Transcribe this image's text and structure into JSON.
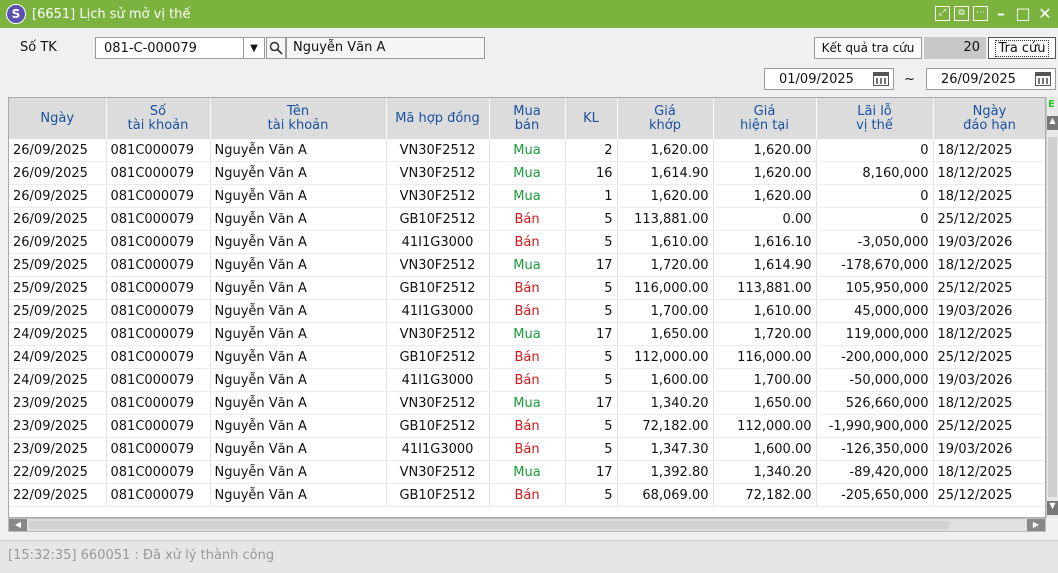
{
  "window": {
    "logo": "S",
    "title": "[6651] Lịch sử mở vị thế"
  },
  "filter": {
    "account_label": "Số TK",
    "account_value": "081-C-000079",
    "account_name": "Nguyễn Văn A",
    "result_label": "Kết quả tra cứu",
    "result_count": "20",
    "search_button": "Tra cứu",
    "from_date": "01/09/2025",
    "separator": "~",
    "to_date": "26/09/2025"
  },
  "table": {
    "headers": [
      {
        "l1": "Ngày",
        "l2": ""
      },
      {
        "l1": "Số",
        "l2": "tài khoản"
      },
      {
        "l1": "Tên",
        "l2": "tài khoản"
      },
      {
        "l1": "Mã hợp đồng",
        "l2": ""
      },
      {
        "l1": "Mua",
        "l2": "bán"
      },
      {
        "l1": "KL",
        "l2": ""
      },
      {
        "l1": "Giá",
        "l2": "khớp"
      },
      {
        "l1": "Giá",
        "l2": "hiện tại"
      },
      {
        "l1": "Lãi lỗ",
        "l2": "vị thế"
      },
      {
        "l1": "Ngày",
        "l2": "đáo hạn"
      }
    ],
    "rows": [
      [
        "26/09/2025",
        "081C000079",
        "Nguyễn Văn A",
        "VN30F2512",
        "Mua",
        "2",
        "1,620.00",
        "1,620.00",
        "0",
        "18/12/2025"
      ],
      [
        "26/09/2025",
        "081C000079",
        "Nguyễn Văn A",
        "VN30F2512",
        "Mua",
        "16",
        "1,614.90",
        "1,620.00",
        "8,160,000",
        "18/12/2025"
      ],
      [
        "26/09/2025",
        "081C000079",
        "Nguyễn Văn A",
        "VN30F2512",
        "Mua",
        "1",
        "1,620.00",
        "1,620.00",
        "0",
        "18/12/2025"
      ],
      [
        "26/09/2025",
        "081C000079",
        "Nguyễn Văn A",
        "GB10F2512",
        "Bán",
        "5",
        "113,881.00",
        "0.00",
        "0",
        "25/12/2025"
      ],
      [
        "26/09/2025",
        "081C000079",
        "Nguyễn Văn A",
        "41I1G3000",
        "Bán",
        "5",
        "1,610.00",
        "1,616.10",
        "-3,050,000",
        "19/03/2026"
      ],
      [
        "25/09/2025",
        "081C000079",
        "Nguyễn Văn A",
        "VN30F2512",
        "Mua",
        "17",
        "1,720.00",
        "1,614.90",
        "-178,670,000",
        "18/12/2025"
      ],
      [
        "25/09/2025",
        "081C000079",
        "Nguyễn Văn A",
        "GB10F2512",
        "Bán",
        "5",
        "116,000.00",
        "113,881.00",
        "105,950,000",
        "25/12/2025"
      ],
      [
        "25/09/2025",
        "081C000079",
        "Nguyễn Văn A",
        "41I1G3000",
        "Bán",
        "5",
        "1,700.00",
        "1,610.00",
        "45,000,000",
        "19/03/2026"
      ],
      [
        "24/09/2025",
        "081C000079",
        "Nguyễn Văn A",
        "VN30F2512",
        "Mua",
        "17",
        "1,650.00",
        "1,720.00",
        "119,000,000",
        "18/12/2025"
      ],
      [
        "24/09/2025",
        "081C000079",
        "Nguyễn Văn A",
        "GB10F2512",
        "Bán",
        "5",
        "112,000.00",
        "116,000.00",
        "-200,000,000",
        "25/12/2025"
      ],
      [
        "24/09/2025",
        "081C000079",
        "Nguyễn Văn A",
        "41I1G3000",
        "Bán",
        "5",
        "1,600.00",
        "1,700.00",
        "-50,000,000",
        "19/03/2026"
      ],
      [
        "23/09/2025",
        "081C000079",
        "Nguyễn Văn A",
        "VN30F2512",
        "Mua",
        "17",
        "1,340.20",
        "1,650.00",
        "526,660,000",
        "18/12/2025"
      ],
      [
        "23/09/2025",
        "081C000079",
        "Nguyễn Văn A",
        "GB10F2512",
        "Bán",
        "5",
        "72,182.00",
        "112,000.00",
        "-1,990,900,000",
        "25/12/2025"
      ],
      [
        "23/09/2025",
        "081C000079",
        "Nguyễn Văn A",
        "41I1G3000",
        "Bán",
        "5",
        "1,347.30",
        "1,600.00",
        "-126,350,000",
        "19/03/2026"
      ],
      [
        "22/09/2025",
        "081C000079",
        "Nguyễn Văn A",
        "VN30F2512",
        "Mua",
        "17",
        "1,392.80",
        "1,340.20",
        "-89,420,000",
        "18/12/2025"
      ],
      [
        "22/09/2025",
        "081C000079",
        "Nguyễn Văn A",
        "GB10F2512",
        "Bán",
        "5",
        "68,069.00",
        "72,182.00",
        "-205,650,000",
        "25/12/2025"
      ]
    ],
    "side_label": "E"
  },
  "status": {
    "message": "[15:32:35] 660051 : Đã xử lý thành công"
  },
  "colors": {
    "titlebar": "#7bb33e",
    "buy": "#1a9a3a",
    "sell": "#d01818",
    "header_text": "#1a52a0"
  },
  "icons": {
    "logo": "app-logo-icon",
    "window_buttons": [
      "restore-icon",
      "popout-icon",
      "options-icon",
      "minimize-icon",
      "maximize-icon",
      "close-icon"
    ],
    "combo": "chevron-down-icon",
    "search": "search-icon",
    "calendar": "calendar-icon"
  }
}
